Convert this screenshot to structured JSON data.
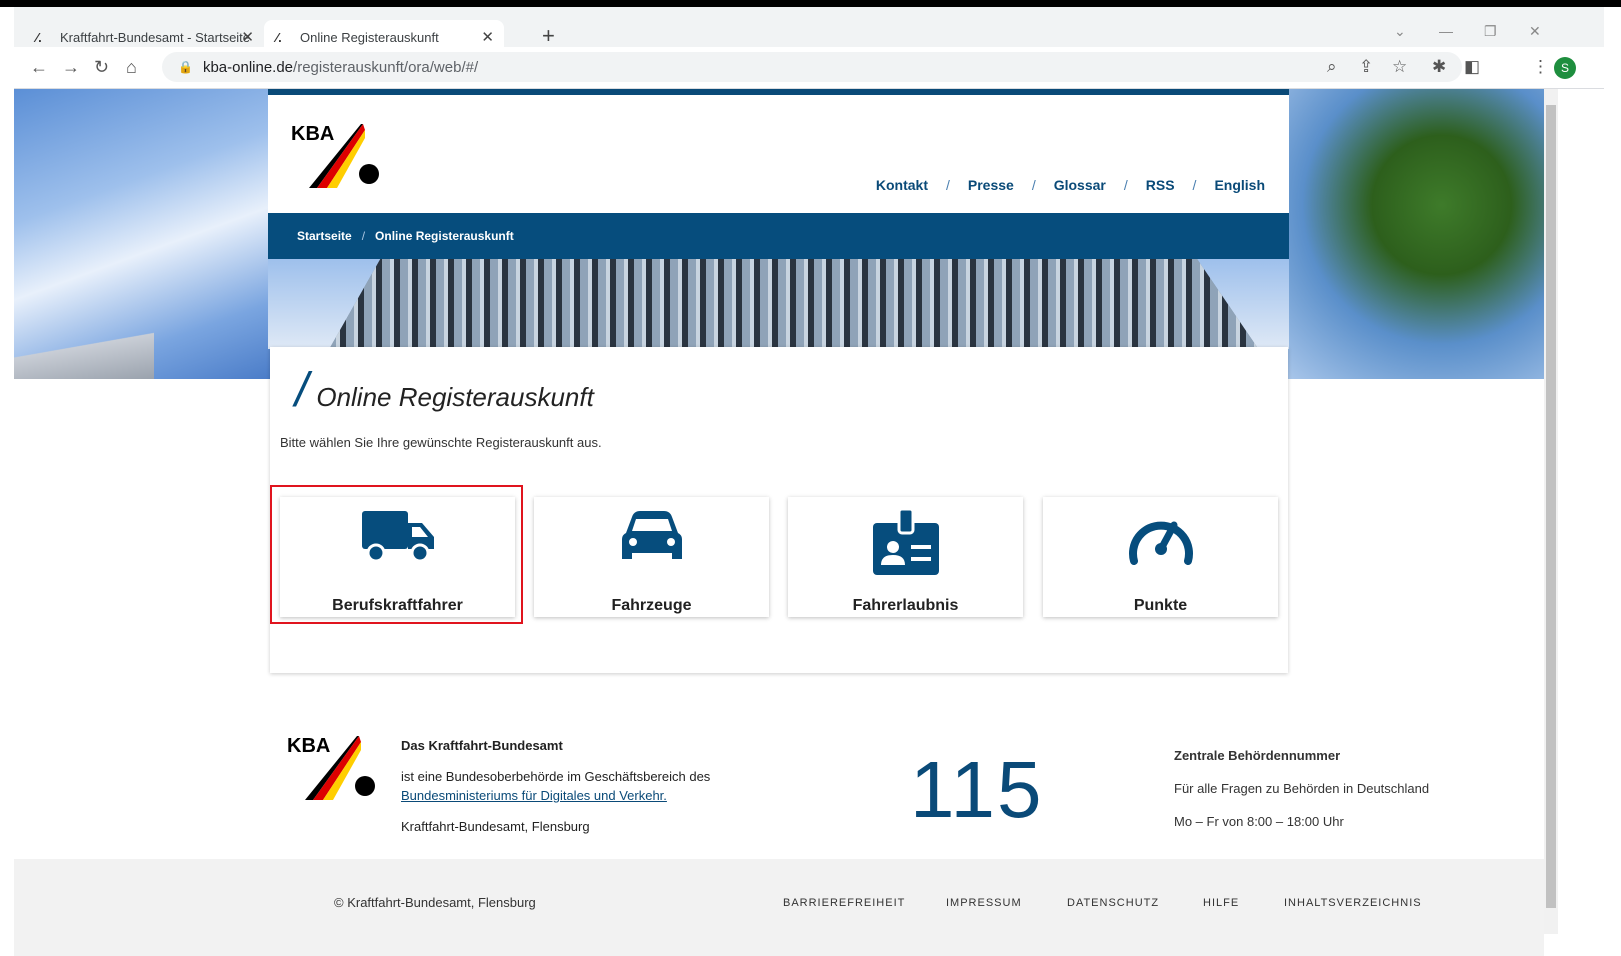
{
  "browser": {
    "tabs": [
      {
        "title": "Kraftfahrt-Bundesamt - Startseite"
      },
      {
        "title": "Online Registerauskunft"
      }
    ],
    "url_host": "kba-online.de",
    "url_path": "/registerauskunft/ora/web/#/",
    "profile_initial": "S"
  },
  "header": {
    "logo_text": "KBA",
    "nav": [
      "Kontakt",
      "Presse",
      "Glossar",
      "RSS",
      "English"
    ],
    "breadcrumb": [
      "Startseite",
      "Online Registerauskunft"
    ]
  },
  "main": {
    "title": "Online Registerauskunft",
    "intro": "Bitte wählen Sie Ihre gewünschte Registerauskunft aus.",
    "tiles": [
      {
        "label": "Berufskraftfahrer",
        "icon": "truck-icon"
      },
      {
        "label": "Fahrzeuge",
        "icon": "car-icon"
      },
      {
        "label": "Fahrerlaubnis",
        "icon": "id-badge-icon"
      },
      {
        "label": "Punkte",
        "icon": "speedometer-icon"
      }
    ]
  },
  "footer": {
    "logo_text": "KBA",
    "org_title": "Das Kraftfahrt-Bundesamt",
    "org_desc": "ist eine Bundesoberbehörde im Geschäftsbereich des",
    "org_link": "Bundesministeriums für Digitales und Verkehr.",
    "org_place": "Kraftfahrt-Bundesamt, Flensburg",
    "number": "115",
    "number_title": "Zentrale Behördennummer",
    "number_desc": "Für alle Fragen zu Behörden in Deutschland",
    "number_hours": "Mo – Fr von 8:00 – 18:00 Uhr",
    "copyright": "© Kraftfahrt-Bundesamt, Flensburg",
    "links": [
      "BARRIEREFREIHEIT",
      "IMPRESSUM",
      "DATENSCHUTZ",
      "HILFE",
      "INHALTSVERZEICHNIS"
    ]
  },
  "colors": {
    "primary": "#064d7d",
    "highlight": "#e0141e"
  }
}
